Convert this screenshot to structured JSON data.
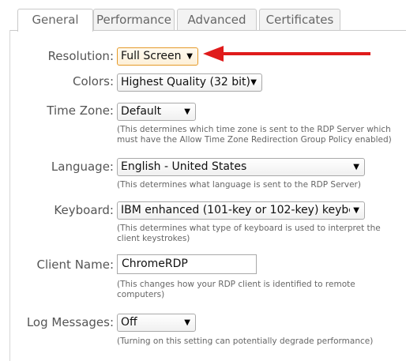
{
  "tabs": [
    {
      "label": "General",
      "active": true
    },
    {
      "label": "Performance",
      "active": false
    },
    {
      "label": "Advanced",
      "active": false
    },
    {
      "label": "Certificates",
      "active": false
    }
  ],
  "form": {
    "resolution": {
      "label": "Resolution:",
      "value": "Full Screen"
    },
    "colors": {
      "label": "Colors:",
      "value": "Highest Quality (32 bit)"
    },
    "time_zone": {
      "label": "Time Zone:",
      "value": "Default",
      "help": "(This determines which time zone is sent to the RDP Server which must have the Allow Time Zone Redirection Group Policy enabled)"
    },
    "language": {
      "label": "Language:",
      "value": "English - United States",
      "help": "(This determines what language is sent to the RDP Server)"
    },
    "keyboard": {
      "label": "Keyboard:",
      "value": "IBM enhanced (101-key or 102-key) keybc",
      "help": "(This determines what type of keyboard is used to interpret the client keystrokes)"
    },
    "client_name": {
      "label": "Client Name:",
      "value": "ChromeRDP",
      "help": "(This changes how your RDP client is identified to remote computers)"
    },
    "log_messages": {
      "label": "Log Messages:",
      "value": "Off",
      "help": "(Turning on this setting can potentially degrade performance)"
    }
  },
  "dropdown_arrow": "▼",
  "colors": {
    "annotation_arrow": "#e01b1b",
    "highlight_border": "#e59a2a"
  }
}
